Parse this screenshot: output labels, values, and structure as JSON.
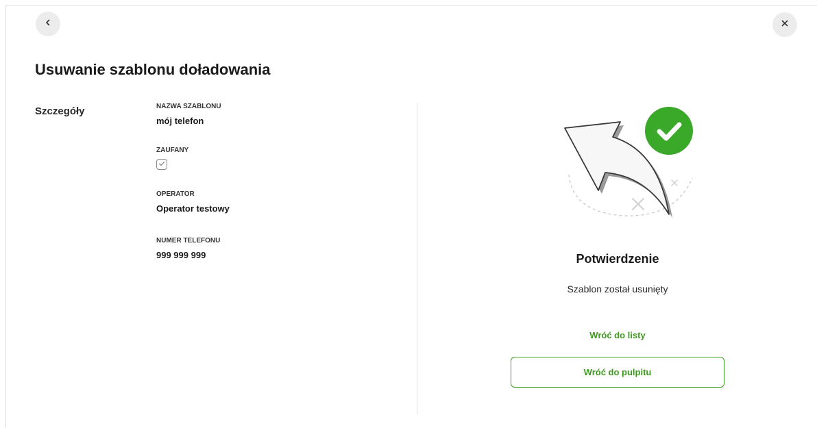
{
  "header": {
    "title": "Usuwanie szablonu doładowania"
  },
  "details": {
    "section_label": "Szczegóły",
    "fields": [
      {
        "label": "NAZWA SZABLONU",
        "value": "mój telefon"
      },
      {
        "label": "ZAUFANY",
        "checked": true
      },
      {
        "label": "OPERATOR",
        "value": "Operator testowy"
      },
      {
        "label": "NUMER TELEFONU",
        "value": "999 999 999"
      }
    ]
  },
  "confirmation": {
    "title": "Potwierdzenie",
    "message": "Szablon został usunięty",
    "back_to_list": "Wróć do listy",
    "back_to_dashboard": "Wróć do pulpitu"
  },
  "icons": {
    "back": "chevron-left-icon",
    "close": "close-icon",
    "illustration": "undo-arrow-success-illustration"
  },
  "colors": {
    "accent": "#3d9a1f",
    "success": "#3aa829"
  }
}
